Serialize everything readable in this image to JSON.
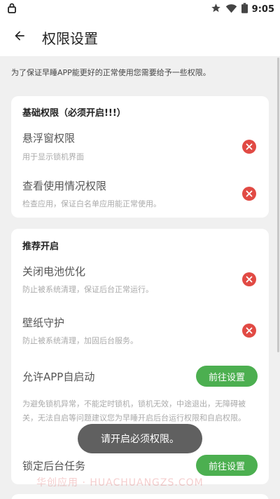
{
  "status": {
    "time": "9:05",
    "icons": [
      "lock-icon",
      "star-icon",
      "wifi-icon",
      "battery-icon"
    ]
  },
  "app_bar": {
    "title": "权限设置",
    "back_icon": "arrow-back-icon"
  },
  "intro": "为了保证早睡APP能更好的正常使用您需要给予一些权限。",
  "basic": {
    "title": "基础权限（必须开启!!!）",
    "items": [
      {
        "title": "悬浮窗权限",
        "desc": "用于显示锁机界面",
        "status_icon": "close-circle-icon"
      },
      {
        "title": "查看使用情况权限",
        "desc": "检查应用，保证白名单应用能正常使用。",
        "status_icon": "close-circle-icon"
      }
    ]
  },
  "recommended": {
    "title": "推荐开启",
    "items": [
      {
        "title": "关闭电池优化",
        "desc": "防止被系统清理，保证后台正常运行。",
        "status_icon": "close-circle-icon"
      },
      {
        "title": "壁纸守护",
        "desc": "防止被系统清理，加固后台服务。",
        "status_icon": "close-circle-icon"
      },
      {
        "title": "允许APP自启动",
        "button": "前往设置",
        "desc": "为避免锁机异常，不能定时锁机，锁机无效，中途退出，无障碍被关，无法自启等问题建议您为早睡开启后台运行权限和自启权限。"
      },
      {
        "title": "锁定后台任务",
        "button": "前往设置"
      }
    ]
  },
  "toast": "请开启必须权限。",
  "watermark": "华创应用 · HUACHUANGZS.COM",
  "colors": {
    "error": "#e14a44",
    "accent": "#4caf50",
    "background": "#f0f0f0"
  }
}
